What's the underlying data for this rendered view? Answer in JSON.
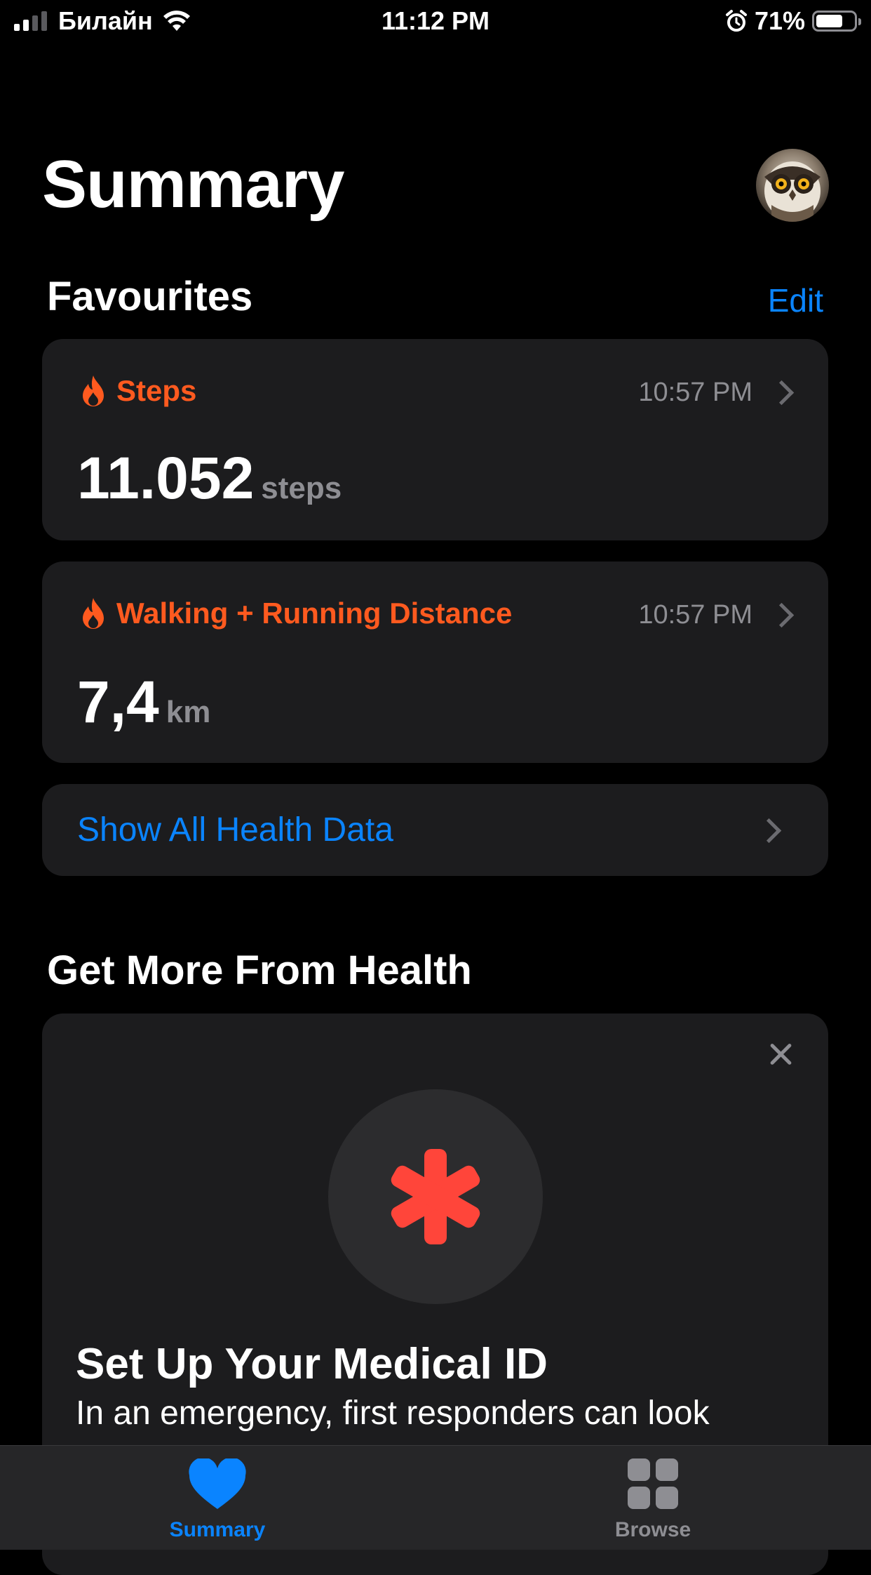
{
  "status_bar": {
    "carrier": "Билайн",
    "time": "11:12 PM",
    "battery_percent": "71%",
    "battery_level": 0.71,
    "signal_bars": 2,
    "icons": [
      "signal-icon",
      "wifi-icon",
      "alarm-icon",
      "battery-icon"
    ]
  },
  "header": {
    "title": "Summary",
    "avatar_icon": "owl-avatar"
  },
  "favourites": {
    "title": "Favourites",
    "edit_label": "Edit",
    "cards": [
      {
        "icon": "flame-icon",
        "label": "Steps",
        "time": "10:57 PM",
        "value": "11.052",
        "unit": "steps"
      },
      {
        "icon": "flame-icon",
        "label": "Walking + Running Distance",
        "time": "10:57 PM",
        "value": "7,4",
        "unit": "km"
      }
    ],
    "show_all_label": "Show All Health Data"
  },
  "get_more": {
    "title": "Get More From Health",
    "card": {
      "icon": "medical-asterisk-icon",
      "title": "Set Up Your Medical ID",
      "text": "In an emergency, first responders can look"
    }
  },
  "tab_bar": {
    "tabs": [
      {
        "label": "Summary",
        "icon": "heart-icon",
        "selected": true
      },
      {
        "label": "Browse",
        "icon": "grid-icon",
        "selected": false
      }
    ]
  },
  "colors": {
    "background": "#000000",
    "card": "#1c1c1e",
    "accent_blue": "#0a84ff",
    "accent_orange": "#ff5a1f",
    "medical_red": "#ff453a",
    "secondary_text": "#8e8e93"
  }
}
